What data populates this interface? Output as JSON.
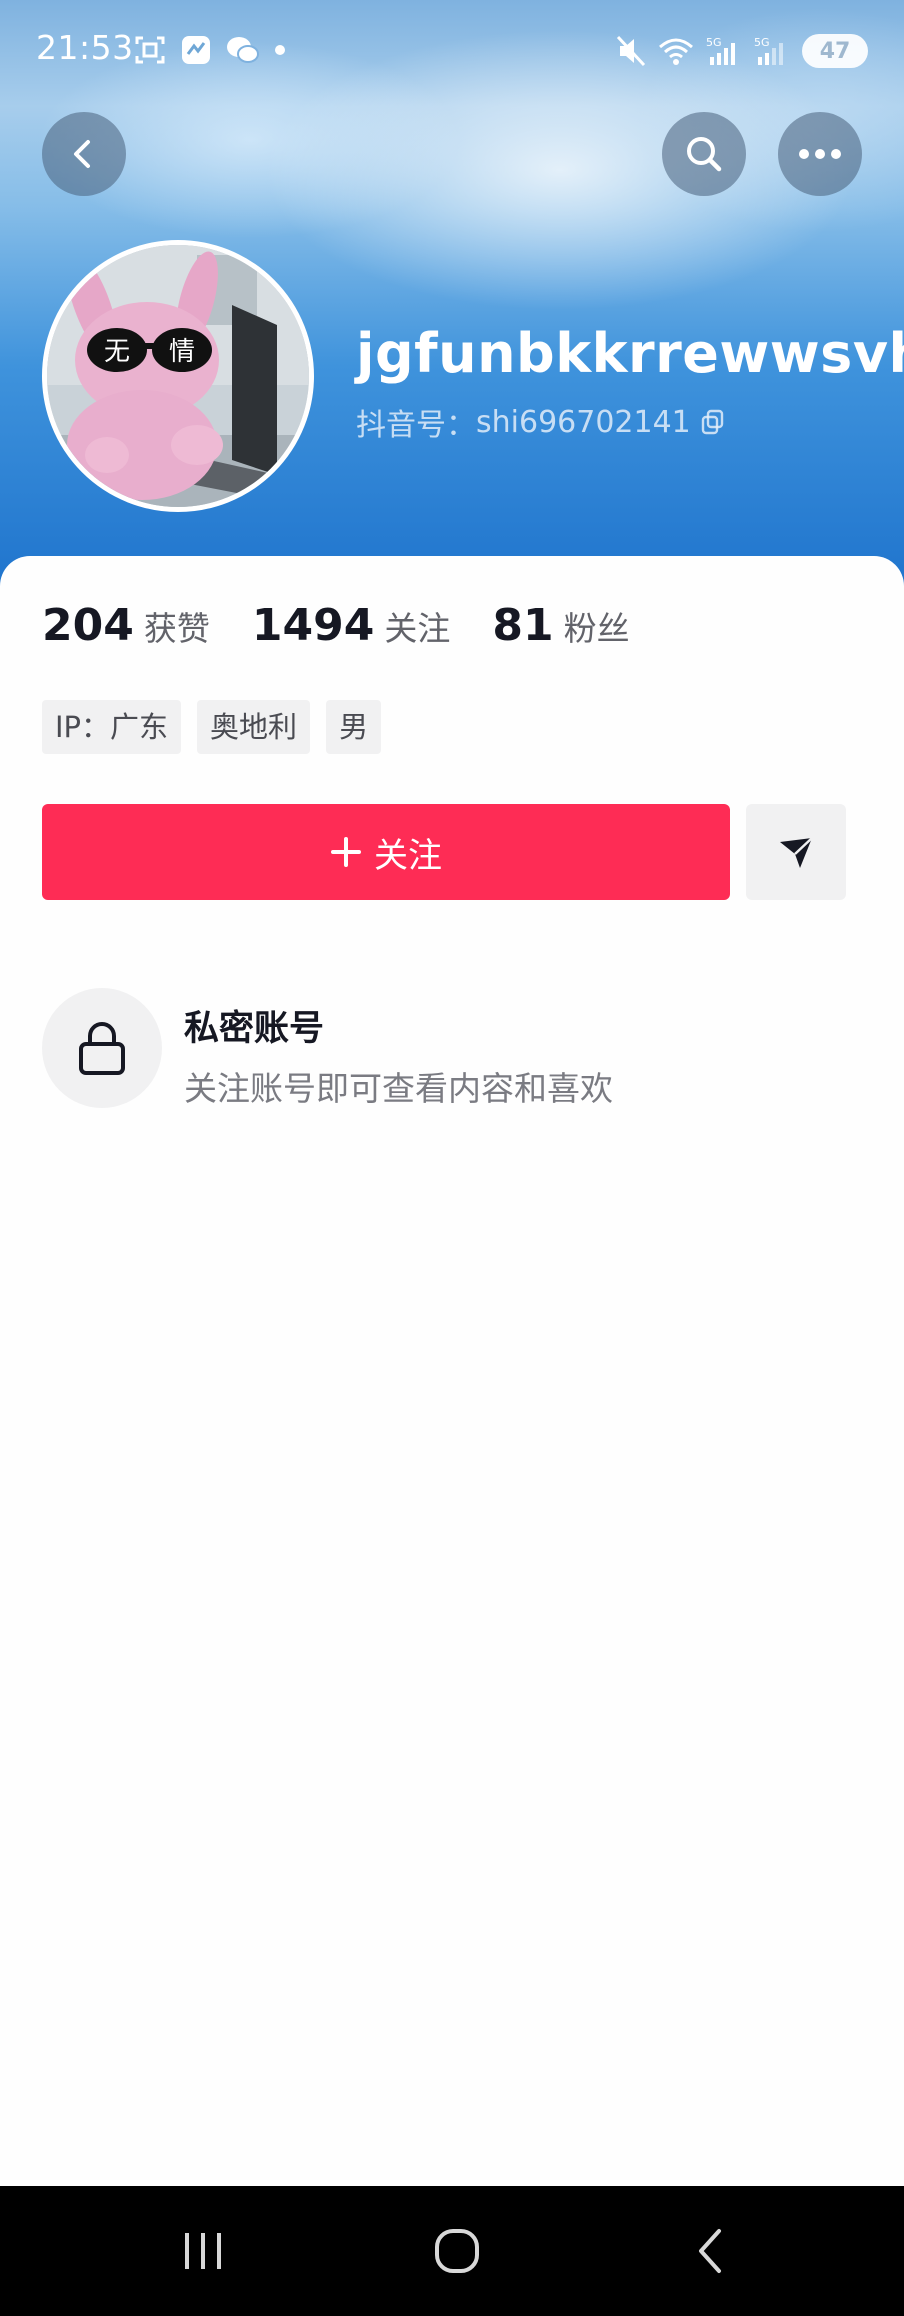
{
  "status_bar": {
    "time": "21:53",
    "battery": "47",
    "icons": [
      "screenshot-icon",
      "app-notification-icon",
      "wechat-icon",
      "dot-icon",
      "mute-icon",
      "wifi-icon",
      "signal-5g-icon",
      "signal-5g-icon",
      "battery-icon"
    ]
  },
  "header": {
    "back_icon": "chevron-left-icon",
    "search_icon": "search-icon",
    "more_icon": "more-dots-icon"
  },
  "profile": {
    "avatar_text_left": "无",
    "avatar_text_right": "情",
    "username": "jgfunbkkrrewwsvh",
    "douyin_id_label": "抖音号：",
    "douyin_id": "shi696702141",
    "copy_icon": "copy-icon"
  },
  "stats": [
    {
      "value": "204",
      "label": "获赞"
    },
    {
      "value": "1494",
      "label": "关注"
    },
    {
      "value": "81",
      "label": "粉丝"
    }
  ],
  "tags": [
    "IP：广东",
    "奥地利",
    "男"
  ],
  "actions": {
    "follow_label": "关注",
    "follow_icon": "plus-icon",
    "share_icon": "send-icon"
  },
  "private": {
    "title": "私密账号",
    "description": "关注账号即可查看内容和喜欢",
    "icon": "lock-icon"
  },
  "colors": {
    "accent": "#fe2c55",
    "banner_top": "#7fb2df",
    "banner_bottom": "#1f74cd"
  }
}
